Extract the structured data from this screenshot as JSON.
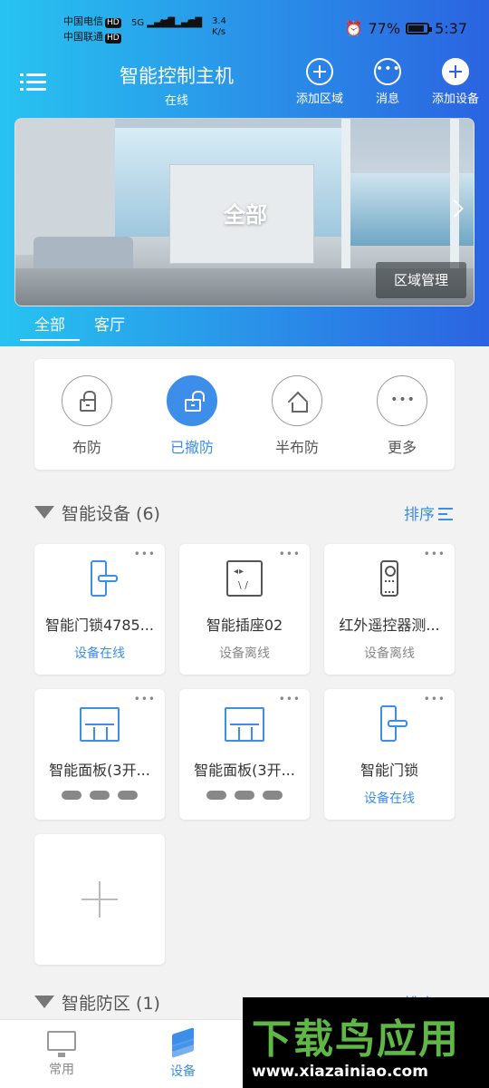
{
  "status_bar": {
    "carrier1": "中国电信",
    "carrier2": "中国联通",
    "hd": "HD",
    "net1": "5G",
    "net2": "4G",
    "speed": "3.4\nK/s",
    "battery": "77%",
    "time": "5:37"
  },
  "header": {
    "title": "智能控制主机",
    "subtitle": "在线",
    "add_area": "添加区域",
    "message": "消息",
    "add_device": "添加设备"
  },
  "banner": {
    "label": "全部",
    "manage": "区域管理"
  },
  "tabs": [
    "全部",
    "客厅"
  ],
  "arm_modes": [
    {
      "label": "布防",
      "icon": "lock-icon"
    },
    {
      "label": "已撤防",
      "icon": "unlock-icon",
      "active": true
    },
    {
      "label": "半布防",
      "icon": "home-icon"
    },
    {
      "label": "更多",
      "icon": "more-icon"
    }
  ],
  "devices_section": {
    "title": "智能设备 (6)",
    "sort": "排序"
  },
  "devices": [
    {
      "name": "智能门锁4785...",
      "status": "设备在线",
      "icon": "door-lock-icon",
      "online": true
    },
    {
      "name": "智能插座02",
      "status": "设备离线",
      "icon": "socket-icon"
    },
    {
      "name": "红外遥控器测...",
      "status": "设备离线",
      "icon": "remote-icon"
    },
    {
      "name": "智能面板(3开...",
      "status": "",
      "icon": "panel-icon"
    },
    {
      "name": "智能面板(3开...",
      "status": "",
      "icon": "panel-icon"
    },
    {
      "name": "智能门锁",
      "status": "设备在线",
      "icon": "door-lock-icon",
      "online": true
    }
  ],
  "zones_section": {
    "title": "智能防区 (1)",
    "sort": "排序"
  },
  "bottom_nav": {
    "common": "常用",
    "devices": "设备"
  },
  "watermark": {
    "brand": "下载鸟应用",
    "url": "www.xiazainiao.com"
  },
  "colors": {
    "accent": "#3d8ee8",
    "header_gradient_start": "#27c3f0",
    "header_gradient_end": "#2b63e0"
  }
}
